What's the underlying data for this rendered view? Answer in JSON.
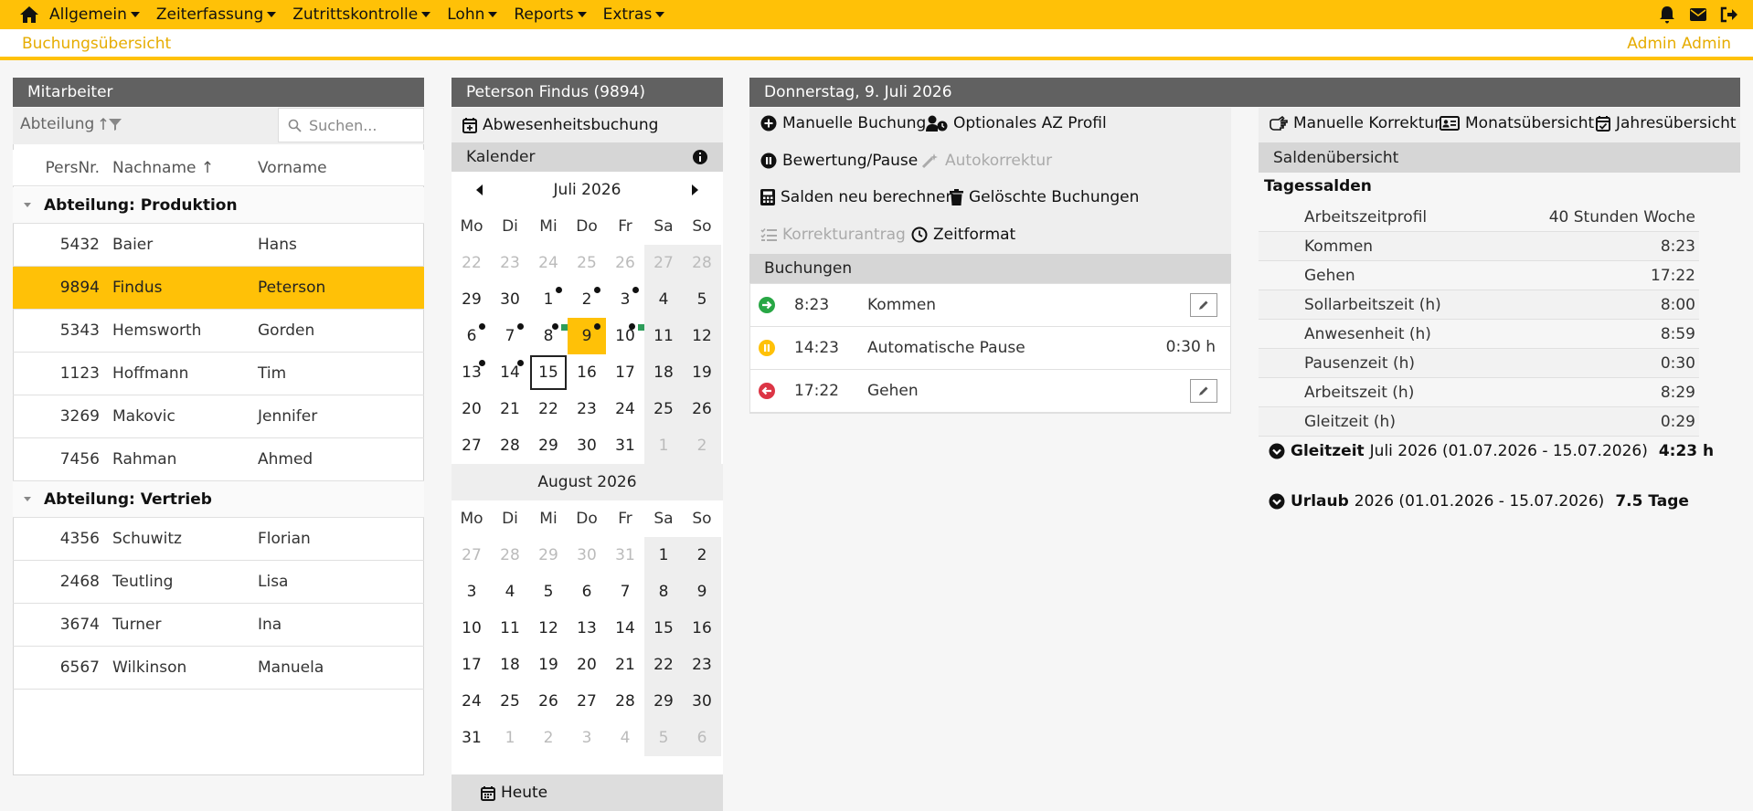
{
  "nav": {
    "menu": [
      "Allgemein",
      "Zeiterfassung",
      "Zutrittskontrolle",
      "Lohn",
      "Reports",
      "Extras"
    ]
  },
  "subbar": {
    "title": "Buchungsübersicht",
    "user": "Admin Admin"
  },
  "employees": {
    "title": "Mitarbeiter",
    "filter_label": "Abteilung",
    "search_placeholder": "Suchen...",
    "columns": [
      "PersNr.",
      "Nachname",
      "Vorname"
    ],
    "groups": [
      {
        "label": "Abteilung: Produktion",
        "rows": [
          {
            "nr": "5432",
            "nachname": "Baier",
            "vorname": "Hans"
          },
          {
            "nr": "9894",
            "nachname": "Findus",
            "vorname": "Peterson"
          },
          {
            "nr": "5343",
            "nachname": "Hemsworth",
            "vorname": "Gorden"
          },
          {
            "nr": "1123",
            "nachname": "Hoffmann",
            "vorname": "Tim"
          },
          {
            "nr": "3269",
            "nachname": "Makovic",
            "vorname": "Jennifer"
          },
          {
            "nr": "7456",
            "nachname": "Rahman",
            "vorname": "Ahmed"
          }
        ]
      },
      {
        "label": "Abteilung: Vertrieb",
        "rows": [
          {
            "nr": "4356",
            "nachname": "Schuwitz",
            "vorname": "Florian"
          },
          {
            "nr": "2468",
            "nachname": "Teutling",
            "vorname": "Lisa"
          },
          {
            "nr": "3674",
            "nachname": "Turner",
            "vorname": "Ina"
          },
          {
            "nr": "6567",
            "nachname": "Wilkinson",
            "vorname": "Manuela"
          }
        ]
      }
    ],
    "selected_nr": "9894"
  },
  "calendar": {
    "title": "Peterson Findus (9894)",
    "absence_button": "Abwesenheitsbuchung",
    "section_label": "Kalender",
    "weekdays": [
      "Mo",
      "Di",
      "Mi",
      "Do",
      "Fr",
      "Sa",
      "So"
    ],
    "month1": {
      "label": "Juli 2026",
      "weeks": [
        [
          "22",
          "23",
          "24",
          "25",
          "26",
          "27",
          "28"
        ],
        [
          "29",
          "30",
          "1",
          "2",
          "3",
          "4",
          "5"
        ],
        [
          "6",
          "7",
          "8",
          "9",
          "10",
          "11",
          "12"
        ],
        [
          "13",
          "14",
          "15",
          "16",
          "17",
          "18",
          "19"
        ],
        [
          "20",
          "21",
          "22",
          "23",
          "24",
          "25",
          "26"
        ],
        [
          "27",
          "28",
          "29",
          "30",
          "31",
          "1",
          "2"
        ]
      ],
      "muted_first_week": true,
      "muted_last_days": 2,
      "dots": [
        "1",
        "2",
        "3",
        "6",
        "7",
        "8",
        "9",
        "10",
        "13",
        "14"
      ],
      "green_marks": [
        "8",
        "10"
      ],
      "selected_day": "9",
      "today_day": "15"
    },
    "month2": {
      "label": "August 2026",
      "weeks": [
        [
          "27",
          "28",
          "29",
          "30",
          "31",
          "1",
          "2"
        ],
        [
          "3",
          "4",
          "5",
          "6",
          "7",
          "8",
          "9"
        ],
        [
          "10",
          "11",
          "12",
          "13",
          "14",
          "15",
          "16"
        ],
        [
          "17",
          "18",
          "19",
          "20",
          "21",
          "22",
          "23"
        ],
        [
          "24",
          "25",
          "26",
          "27",
          "28",
          "29",
          "30"
        ],
        [
          "31",
          "1",
          "2",
          "3",
          "4",
          "5",
          "6"
        ]
      ]
    },
    "today_button": "Heute"
  },
  "day": {
    "title": "Donnerstag, 9. Juli 2026",
    "actions": {
      "manual_booking": "Manuelle Buchung",
      "optional_profile": "Optionales AZ Profil",
      "rating_pause": "Bewertung/Pause",
      "auto_correction": "Autokorrektur",
      "recalc": "Salden neu berechnen",
      "deleted": "Gelöschte Buchungen",
      "correction_request": "Korrekturantrag",
      "time_format": "Zeitformat"
    },
    "bookings_title": "Buchungen",
    "bookings": [
      {
        "time": "8:23",
        "type": "Kommen",
        "status_color": "#28a745",
        "value": ""
      },
      {
        "time": "14:23",
        "type": "Automatische Pause",
        "status_color": "#ffc107",
        "value": "0:30 h"
      },
      {
        "time": "17:22",
        "type": "Gehen",
        "status_color": "#dc3545",
        "value": ""
      }
    ]
  },
  "saldo": {
    "actions": {
      "manual_correction": "Manuelle Korrektur",
      "month_overview": "Monatsübersicht",
      "year_overview": "Jahresübersicht"
    },
    "title": "Saldenübersicht",
    "daily_title": "Tagessalden",
    "rows": [
      {
        "label": "Arbeitszeitprofil",
        "value": "40 Stunden Woche"
      },
      {
        "label": "Kommen",
        "value": "8:23"
      },
      {
        "label": "Gehen",
        "value": "17:22"
      },
      {
        "label": "Sollarbeitszeit (h)",
        "value": "8:00"
      },
      {
        "label": "Anwesenheit (h)",
        "value": "8:59"
      },
      {
        "label": "Pausenzeit (h)",
        "value": "0:30"
      },
      {
        "label": "Arbeitszeit (h)",
        "value": "8:29"
      },
      {
        "label": "Gleitzeit (h)",
        "value": "0:29"
      }
    ],
    "gleitzeit": {
      "label": "Gleitzeit",
      "range": "Juli 2026 (01.07.2026 - 15.07.2026)",
      "value": "4:23 h"
    },
    "urlaub": {
      "label": "Urlaub",
      "range": "2026 (01.01.2026 - 15.07.2026)",
      "value": "7.5 Tage"
    }
  },
  "colors": {
    "accent": "#ffc107",
    "header": "#616161"
  }
}
